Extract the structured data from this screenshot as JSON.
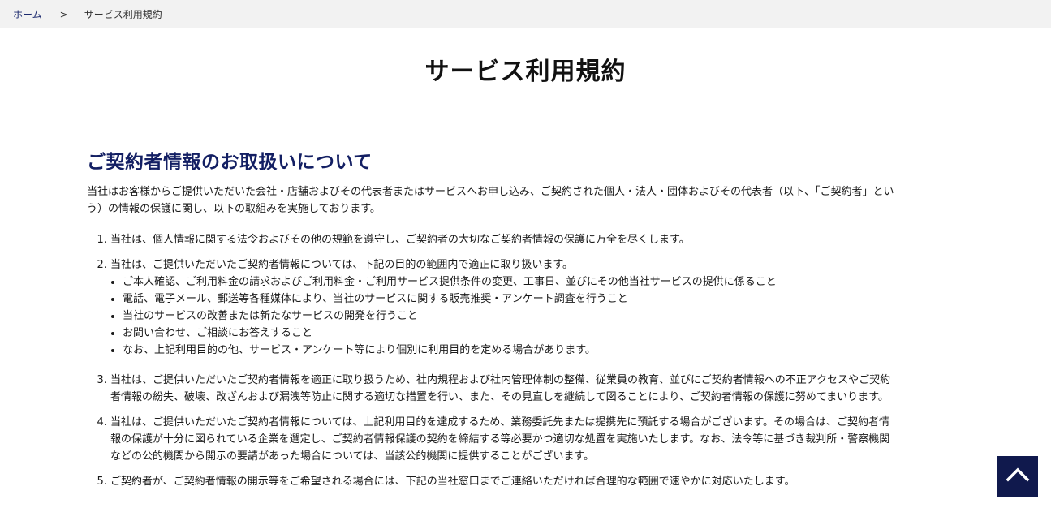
{
  "breadcrumb": {
    "home": "ホーム",
    "separator": ">",
    "current": "サービス利用規約"
  },
  "page_title": "サービス利用規約",
  "section": {
    "heading": "ご契約者情報のお取扱いについて",
    "intro": "当社はお客様からご提供いただいた会社・店舗およびその代表者またはサービスへお申し込み、ご契約された個人・法人・団体およびその代表者（以下、「ご契約者」という）の情報の保護に関し、以下の取組みを実施しております。",
    "items": [
      {
        "text": "当社は、個人情報に関する法令およびその他の規範を遵守し、ご契約者の大切なご契約者情報の保護に万全を尽くします。"
      },
      {
        "text": "当社は、ご提供いただいたご契約者情報については、下記の目的の範囲内で適正に取り扱います。",
        "bullets": [
          "ご本人確認、ご利用料金の請求およびご利用料金・ご利用サービス提供条件の変更、工事日、並びにその他当社サービスの提供に係ること",
          "電話、電子メール、郵送等各種媒体により、当社のサービスに関する販売推奨・アンケート調査を行うこと",
          "当社のサービスの改善または新たなサービスの開発を行うこと",
          "お問い合わせ、ご相談にお答えすること",
          "なお、上記利用目的の他、サービス・アンケート等により個別に利用目的を定める場合があります。"
        ]
      },
      {
        "text": "当社は、ご提供いただいたご契約者情報を適正に取り扱うため、社内規程および社内管理体制の整備、従業員の教育、並びにご契約者情報への不正アクセスやご契約者情報の紛失、破壊、改ざんおよび漏洩等防止に関する適切な措置を行い、また、その見直しを継続して図ることにより、ご契約者情報の保護に努めてまいります。"
      },
      {
        "text": "当社は、ご提供いただいたご契約者情報については、上記利用目的を達成するため、業務委託先または提携先に預託する場合がございます。その場合は、ご契約者情報の保護が十分に図られている企業を選定し、ご契約者情報保護の契約を締結する等必要かつ適切な処置を実施いたします。なお、法令等に基づき裁判所・警察機関などの公的機関から開示の要請があった場合については、当該公的機関に提供することがございます。"
      },
      {
        "text": "ご契約者が、ご契約者情報の開示等をご希望される場合には、下記の当社窓口までご連絡いただければ合理的な範囲で速やかに対応いたします。"
      }
    ]
  },
  "scroll_top": {
    "icon": "chevron-up-icon",
    "color": "#10194d"
  },
  "colors": {
    "heading": "#131f63",
    "link": "#1c2a6e",
    "breadcrumb_bg": "#f2f2f2"
  }
}
